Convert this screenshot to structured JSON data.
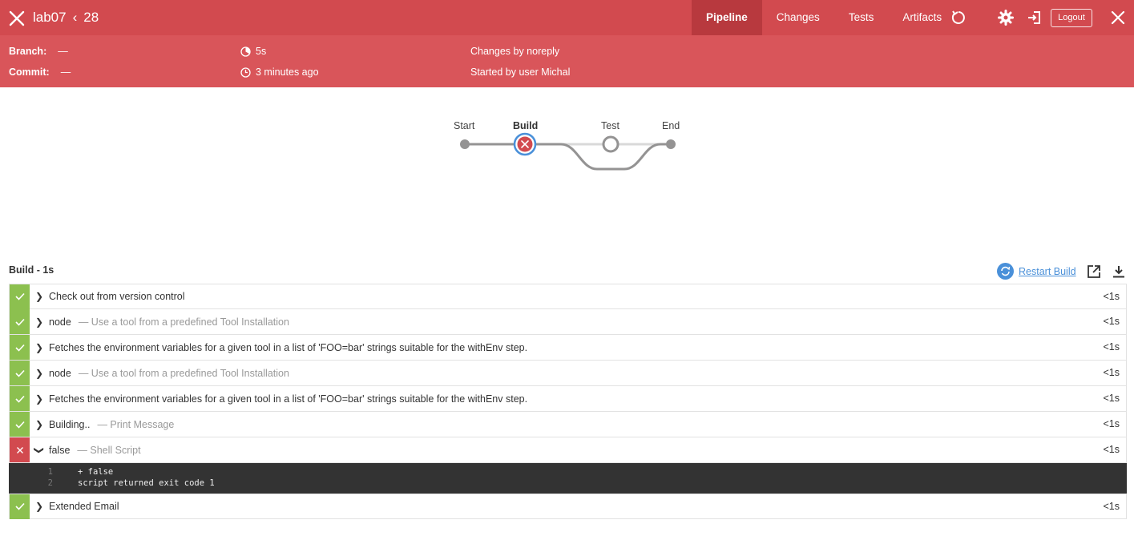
{
  "header": {
    "job": "lab07",
    "build_number": "28",
    "tabs": [
      "Pipeline",
      "Changes",
      "Tests",
      "Artifacts"
    ],
    "logout_label": "Logout"
  },
  "summary": {
    "branch_label": "Branch:",
    "branch_value": "—",
    "commit_label": "Commit:",
    "commit_value": "—",
    "duration": "5s",
    "time_ago": "3 minutes ago",
    "changes_by": "Changes by noreply",
    "started_by": "Started by user Michal"
  },
  "pipeline": {
    "stages": [
      {
        "label": "Start",
        "state": "node"
      },
      {
        "label": "Build",
        "state": "failed"
      },
      {
        "label": "Test",
        "state": "not-run"
      },
      {
        "label": "End",
        "state": "node"
      }
    ]
  },
  "build": {
    "title": "Build - 1s",
    "restart_label": "Restart Build",
    "steps": [
      {
        "name": "Check out from version control",
        "desc": "",
        "duration": "<1s",
        "status": "ok",
        "expanded": false
      },
      {
        "name": "node",
        "desc": "— Use a tool from a predefined Tool Installation",
        "duration": "<1s",
        "status": "ok",
        "expanded": false
      },
      {
        "name": "Fetches the environment variables for a given tool in a list of 'FOO=bar' strings suitable for the withEnv step.",
        "desc": "",
        "duration": "<1s",
        "status": "ok",
        "expanded": false
      },
      {
        "name": "node",
        "desc": "— Use a tool from a predefined Tool Installation",
        "duration": "<1s",
        "status": "ok",
        "expanded": false
      },
      {
        "name": "Fetches the environment variables for a given tool in a list of 'FOO=bar' strings suitable for the withEnv step.",
        "desc": "",
        "duration": "<1s",
        "status": "ok",
        "expanded": false
      },
      {
        "name": "Building..",
        "desc": "— Print Message",
        "duration": "<1s",
        "status": "ok",
        "expanded": false
      },
      {
        "name": "false",
        "desc": "— Shell Script",
        "duration": "<1s",
        "status": "fail",
        "expanded": true
      },
      {
        "name": "Extended Email",
        "desc": "",
        "duration": "<1s",
        "status": "ok",
        "expanded": false
      }
    ],
    "log": [
      {
        "n": "1",
        "text": "+ false"
      },
      {
        "n": "2",
        "text": "script returned exit code 1"
      }
    ]
  },
  "colors": {
    "header_red": "#d24a4f",
    "success_green": "#8cc04f",
    "link_blue": "#4a90d9"
  }
}
